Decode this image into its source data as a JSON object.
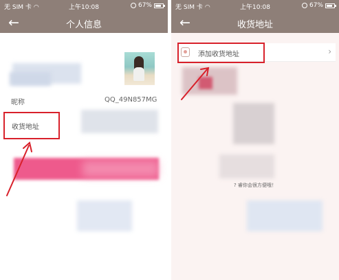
{
  "status_bar": {
    "carrier": "无 SIM 卡",
    "time": "上午10:08",
    "battery": "67%"
  },
  "left_screen": {
    "title": "个人信息",
    "nickname_label": "昵称",
    "nickname_value": "QQ_49N857MG",
    "address_label": "收货地址"
  },
  "right_screen": {
    "title": "收货地址",
    "add_address_label": "添加收货地址",
    "chevron": "›",
    "hint_fragment": "? 睿你会很方便哦！"
  },
  "icons": {
    "back": "back-arrow-icon",
    "wifi": "wifi-icon",
    "battery": "battery-icon",
    "lock": "rotation-lock-icon",
    "location": "location-pin-icon",
    "chevron": "chevron-right-icon"
  },
  "colors": {
    "nav_bar": "#8e7f78",
    "highlight": "#d8202a",
    "pink_button": "#ee5a8c",
    "right_background": "#fbf3f2"
  }
}
